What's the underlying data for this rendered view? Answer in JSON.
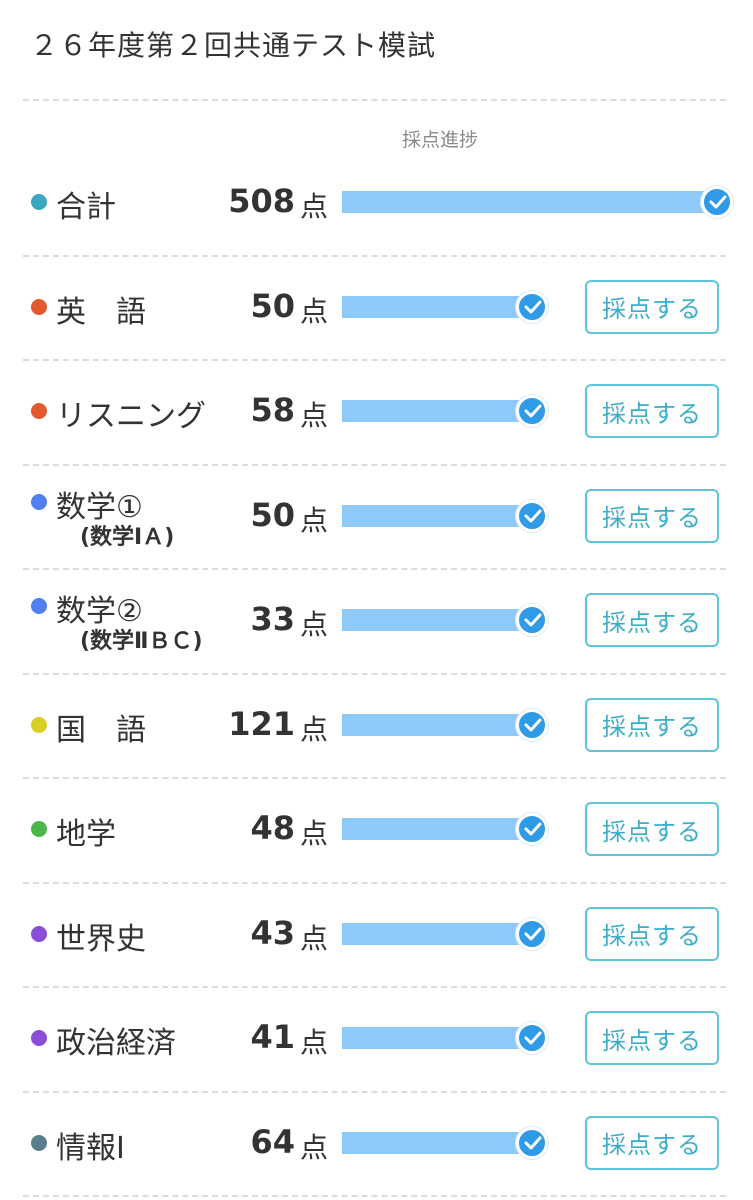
{
  "title": "２６年度第２回共通テスト模試",
  "progress_header": "採点進捗",
  "unit": "点",
  "grade_button_label": "採点する",
  "rows": [
    {
      "name": "合計",
      "sub": "",
      "score": "508",
      "dot_color": "#3aa6bf",
      "progress": 1.0,
      "has_button": false
    },
    {
      "name": "英　語",
      "sub": "",
      "score": "50",
      "dot_color": "#e05a2b",
      "progress": 1.0,
      "has_button": true
    },
    {
      "name": "リスニング",
      "sub": "",
      "score": "58",
      "dot_color": "#e05a2b",
      "progress": 1.0,
      "has_button": true
    },
    {
      "name": "数学①",
      "sub": "(数学ⅠＡ)",
      "score": "50",
      "dot_color": "#4f7ff0",
      "progress": 1.0,
      "has_button": true
    },
    {
      "name": "数学②",
      "sub": "(数学ⅡＢＣ)",
      "score": "33",
      "dot_color": "#4f7ff0",
      "progress": 1.0,
      "has_button": true
    },
    {
      "name": "国　語",
      "sub": "",
      "score": "121",
      "dot_color": "#d9cf22",
      "progress": 1.0,
      "has_button": true
    },
    {
      "name": "地学",
      "sub": "",
      "score": "48",
      "dot_color": "#4cb64a",
      "progress": 1.0,
      "has_button": true
    },
    {
      "name": "世界史",
      "sub": "",
      "score": "43",
      "dot_color": "#8a4fd8",
      "progress": 1.0,
      "has_button": true
    },
    {
      "name": "政治経済",
      "sub": "",
      "score": "41",
      "dot_color": "#8a4fd8",
      "progress": 1.0,
      "has_button": true
    },
    {
      "name": "情報Ⅰ",
      "sub": "",
      "score": "64",
      "dot_color": "#5a7f8c",
      "progress": 1.0,
      "has_button": true
    }
  ]
}
